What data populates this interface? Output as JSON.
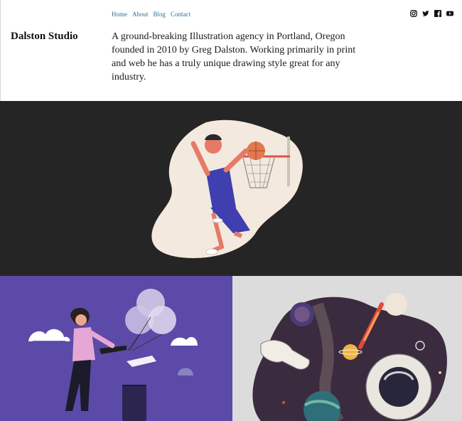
{
  "nav": {
    "items": [
      {
        "label": "Home"
      },
      {
        "label": "About"
      },
      {
        "label": "Blog"
      },
      {
        "label": "Contact"
      }
    ]
  },
  "social": {
    "icons": [
      "instagram-icon",
      "twitter-icon",
      "facebook-icon",
      "youtube-icon"
    ]
  },
  "brand": {
    "name": "Dalston Studio"
  },
  "intro": {
    "text": "A ground-breaking Illustration agency in Portland, Oregon founded in 2010 by Greg Dalston. Working primarily in print and web he has a truly unique drawing style great for any industry."
  },
  "colors": {
    "link": "#2a6f97",
    "hero_bg": "#252525",
    "left_tile_bg": "#5b4aa8",
    "right_tile_bg": "#dcdcdc"
  }
}
